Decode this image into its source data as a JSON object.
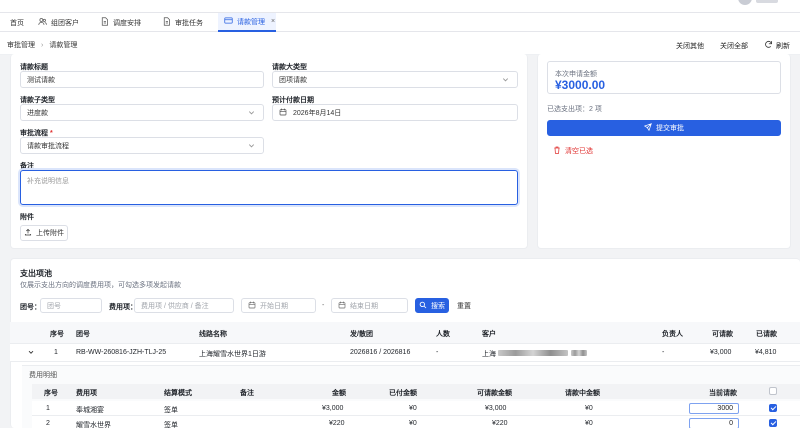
{
  "topnav": {
    "tabs": [
      {
        "label": "首页",
        "icon": ""
      },
      {
        "label": "组团客户",
        "icon": "users-icon"
      },
      {
        "label": "调度安排",
        "icon": "file-icon"
      },
      {
        "label": "审批任务",
        "icon": "file-icon"
      },
      {
        "label": "请款管理",
        "icon": "card-icon",
        "close": "×"
      }
    ]
  },
  "breadcrumb": {
    "parent": "审批管理",
    "sep": "›",
    "current": "请款管理"
  },
  "crumb_actions": {
    "close_others": "关闭其他",
    "close_all": "关闭全部",
    "refresh": "刷新"
  },
  "form": {
    "title_label": "请款标题",
    "title_value": "测试请款",
    "major_label": "请款大类型",
    "major_value": "团项请款",
    "sub_label": "请款子类型",
    "sub_value": "进度款",
    "date_label": "预计付款日期",
    "date_value": "2026年8月14日",
    "flow_label": "审批流程",
    "flow_required": "*",
    "flow_value": "请款审批流程",
    "remark_label": "备注",
    "remark_placeholder": "补充说明信息",
    "attach_label": "附件",
    "upload_label": "上传附件"
  },
  "summary": {
    "amount_label": "本次申请金额",
    "amount_value": "¥3000.00",
    "selected_text": "已选支出项：2 项",
    "submit_label": "提交审批",
    "clear_label": "清空已选"
  },
  "pool": {
    "title": "支出项池",
    "subtitle": "仅展示支出方向的调度费用项，可勾选多项发起请款",
    "group_label": "团号：",
    "group_placeholder": "团号",
    "fee_label": "费用项：",
    "fee_placeholder": "费用项 / 供应商 / 备注",
    "start_placeholder": "开始日期",
    "dash": "-",
    "end_placeholder": "结束日期",
    "search_label": "搜索",
    "reset_label": "重置"
  },
  "table": {
    "headers": [
      "序号",
      "团号",
      "线路名称",
      "发/散团",
      "人数",
      "客户",
      "负责人",
      "可请款",
      "已请款"
    ],
    "row": {
      "index": "1",
      "group": "RB-WW-260816-JZH-TLJ-25",
      "route": "上海耀雪水世界1日游",
      "date": "2026816 / 2026816",
      "people": "-",
      "customer_prefix": "上海",
      "manager": "-",
      "available": "¥3,000",
      "requested": "¥4,810"
    }
  },
  "detail": {
    "title": "费用明细",
    "headers": [
      "序号",
      "费用项",
      "结算模式",
      "备注",
      "金额",
      "已付金额",
      "可请款金额",
      "请款中金额",
      "当前请款"
    ],
    "rows": [
      {
        "index": "1",
        "item": "奉城湘宴",
        "mode": "签单",
        "remark": "",
        "amount": "¥3,000",
        "paid": "¥0",
        "available": "¥3,000",
        "pending": "¥0",
        "current": "3000",
        "checked": true
      },
      {
        "index": "2",
        "item": "耀雪水世界",
        "mode": "签单",
        "remark": "",
        "amount": "¥220",
        "paid": "¥0",
        "available": "¥220",
        "pending": "¥0",
        "current": "0",
        "checked": true
      }
    ]
  },
  "colors": {
    "accent": "#2860e1",
    "danger": "#e0302f"
  }
}
